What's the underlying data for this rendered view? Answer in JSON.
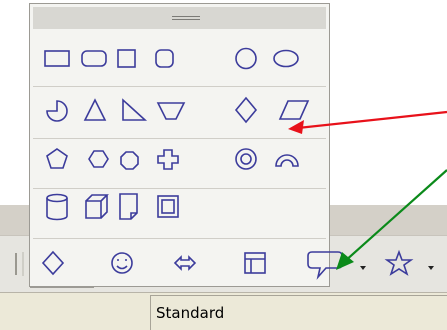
{
  "status_bar": {
    "label": "Standard"
  },
  "shape_menu": {
    "rows": [
      {
        "name": "basic-shapes-row-1",
        "shapes": [
          "rectangle",
          "rounded-rectangle",
          "square",
          "rounded-square",
          "circle",
          "ellipse"
        ]
      },
      {
        "name": "basic-shapes-row-2",
        "shapes": [
          "circle-pie",
          "isosceles-triangle",
          "right-triangle",
          "trapezoid",
          "diamond",
          "parallelogram"
        ]
      },
      {
        "name": "basic-shapes-row-3",
        "shapes": [
          "pentagon",
          "hexagon",
          "octagon",
          "cross",
          "ring",
          "block-arc"
        ]
      },
      {
        "name": "basic-shapes-row-4",
        "shapes": [
          "cylinder",
          "cube",
          "folded-corner",
          "frame"
        ]
      }
    ]
  },
  "toolbar": {
    "buttons": [
      "basic-shapes",
      "symbol-shapes",
      "block-arrows",
      "flowchart",
      "callouts",
      "stars"
    ]
  },
  "colors": {
    "shape_stroke": "#3c3c9c",
    "arrow_red": "#e8111a",
    "arrow_green": "#0b8a1a"
  }
}
